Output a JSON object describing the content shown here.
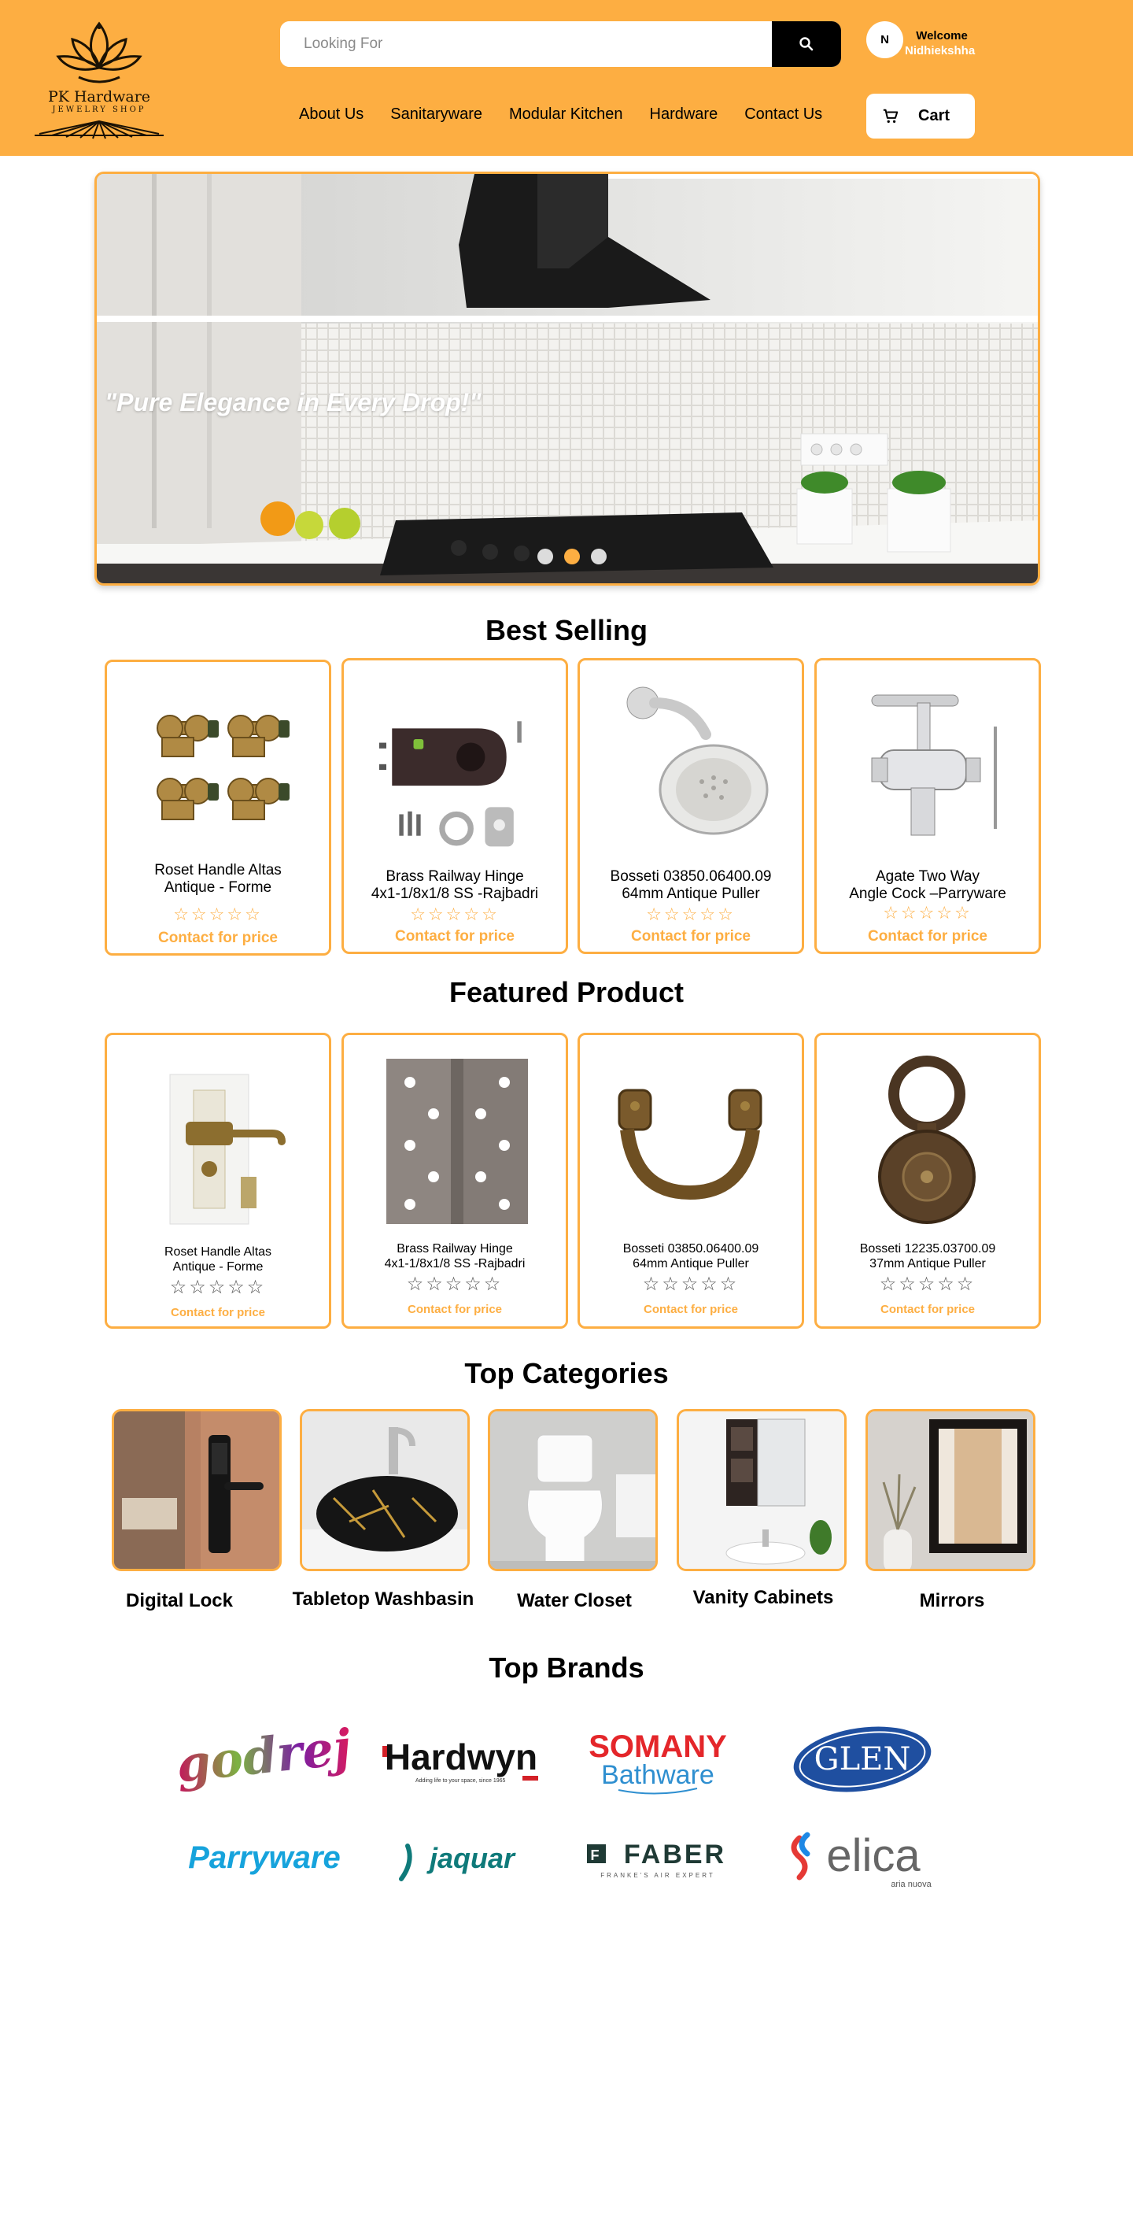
{
  "header": {
    "logo": {
      "name": "PK Hardware",
      "tagline": "JEWELRY SHOP"
    },
    "search": {
      "placeholder": "Looking For",
      "icon": "search-icon"
    },
    "user": {
      "initial": "N",
      "welcome_label": "Welcome",
      "name": "Nidhiekshha"
    },
    "nav": [
      "About Us",
      "Sanitaryware",
      "Modular Kitchen",
      "Hardware",
      "Contact Us"
    ],
    "cart": {
      "label": "Cart",
      "icon": "cart-icon"
    },
    "colors": {
      "brand": "#fdae42",
      "dark": "#000000"
    }
  },
  "hero": {
    "tagline": "\"Pure Elegance in Every Drop!\"",
    "slides": 3,
    "active_slide": 1
  },
  "best_selling": {
    "title": "Best Selling",
    "products": [
      {
        "name": "Roset Handle Altas\nAntique - Forme",
        "rating": 0,
        "stars": "☆☆☆☆☆",
        "price": "Contact for price",
        "image": "brass-knobs"
      },
      {
        "name": "Brass Railway Hinge\n4x1-1/8x1/8 SS -Rajbadri",
        "rating": 0,
        "stars": "☆☆☆☆☆",
        "price": "Contact for price",
        "image": "door-lock"
      },
      {
        "name": "Bosseti 03850.06400.09\n64mm Antique Puller",
        "rating": 0,
        "stars": "☆☆☆☆☆",
        "price": "Contact for price",
        "image": "shower-head"
      },
      {
        "name": "Agate Two Way\nAngle Cock –Parryware",
        "rating": 0,
        "stars": "☆☆☆☆☆",
        "price": "Contact for price",
        "image": "angle-cock"
      }
    ]
  },
  "featured": {
    "title": "Featured Product",
    "products": [
      {
        "name": "Roset Handle Altas\nAntique - Forme",
        "rating": 0,
        "stars": "☆☆☆☆☆",
        "price": "Contact for price",
        "image": "mortise-lock"
      },
      {
        "name": "Brass Railway Hinge\n4x1-1/8x1/8 SS -Rajbadri",
        "rating": 0,
        "stars": "☆☆☆☆☆",
        "price": "Contact for price",
        "image": "hinge"
      },
      {
        "name": "Bosseti 03850.06400.09\n64mm Antique Puller",
        "rating": 0,
        "stars": "☆☆☆☆☆",
        "price": "Contact for price",
        "image": "antique-puller"
      },
      {
        "name": "Bosseti 12235.03700.09\n37mm Antique Puller",
        "rating": 0,
        "stars": "☆☆☆☆☆",
        "price": "Contact for price",
        "image": "ring-puller"
      }
    ]
  },
  "categories": {
    "title": "Top Categories",
    "items": [
      {
        "name": "Digital Lock",
        "image": "digital-lock"
      },
      {
        "name": "Tabletop Washbasin",
        "image": "washbasin"
      },
      {
        "name": "Water Closet",
        "image": "water-closet"
      },
      {
        "name": "Vanity Cabinets",
        "image": "vanity-cabinet"
      },
      {
        "name": "Mirrors",
        "image": "mirror"
      }
    ]
  },
  "brands": {
    "title": "Top Brands",
    "items": [
      {
        "name": "Godrej"
      },
      {
        "name": "Hardwyn",
        "tagline": "Adding life to your space, since 1965"
      },
      {
        "name": "SOMANY",
        "sub": "Bathware"
      },
      {
        "name": "GLEN"
      },
      {
        "name": "Parryware"
      },
      {
        "name": "jaquar"
      },
      {
        "name": "FABER",
        "tagline": "FRANKE'S AIR EXPERT"
      },
      {
        "name": "elica",
        "tagline": "aria nuova"
      }
    ]
  }
}
